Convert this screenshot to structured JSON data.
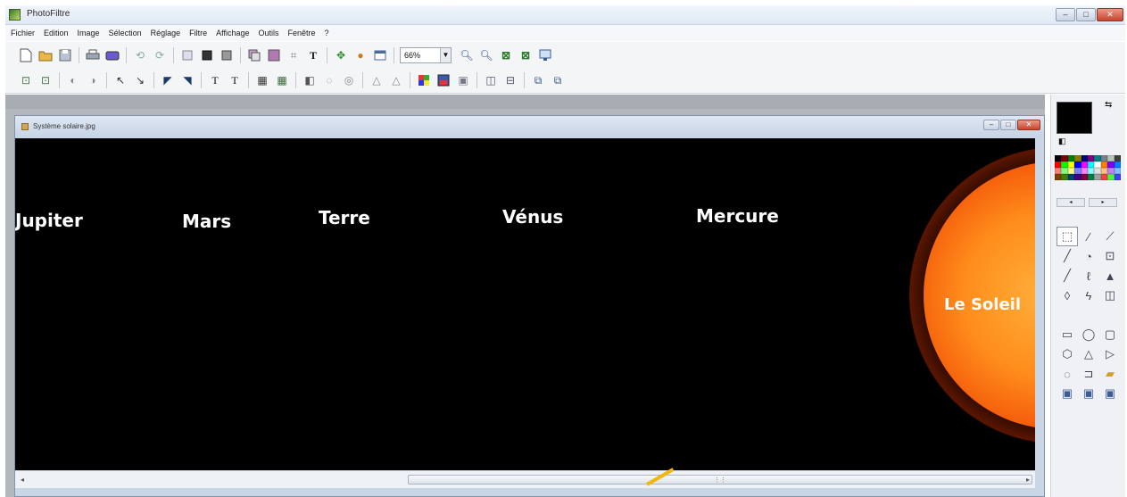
{
  "app": {
    "title": "PhotoFiltre"
  },
  "window_controls": {
    "minimize": "–",
    "maximize": "□",
    "close": "✕"
  },
  "menu": [
    "Fichier",
    "Edition",
    "Image",
    "Sélection",
    "Réglage",
    "Filtre",
    "Affichage",
    "Outils",
    "Fenêtre",
    "?"
  ],
  "toolbar1": {
    "group1": [
      "new-file-icon",
      "open-folder-icon",
      "save-icon"
    ],
    "group2": [
      "print-icon",
      "scanner-icon"
    ],
    "group3": [
      "undo-icon",
      "redo-icon"
    ],
    "group4": [
      "copy-icon",
      "paste-icon",
      "paste-new-icon"
    ],
    "group5": [
      "layer-icon",
      "layer-copy-icon",
      "crop-icon",
      "text-icon"
    ],
    "group6": [
      "move-icon",
      "stamp-icon",
      "window-icon"
    ],
    "zoom_value": "66%",
    "group7": [
      "zoom-in-icon",
      "zoom-out-icon",
      "actual-size-icon",
      "fit-window-icon",
      "fullscreen-icon"
    ]
  },
  "toolbar2": {
    "icons": [
      "resize-image-icon",
      "canvas-size-icon",
      "sharpen-icon",
      "blur-icon",
      "brightness-plus-icon",
      "brightness-minus-icon",
      "contrast-plus-icon",
      "contrast-minus-icon",
      "gamma-plus-icon",
      "gamma-minus-icon",
      "saturation-icon",
      "grayscale-icon",
      "sepia-icon",
      "invert-icon",
      "auto-levels-icon",
      "color-balance-icon",
      "histogram-icon",
      "flip-h-icon",
      "flip-v-icon",
      "rotate-icon",
      "transform-icon"
    ]
  },
  "document": {
    "title": "Système solaire.jpg",
    "labels": {
      "jupiter": "Jupiter",
      "mars": "Mars",
      "terre": "Terre",
      "venus": "Vénus",
      "mercure": "Mercure",
      "soleil": "Le Soleil"
    }
  },
  "colors": {
    "foreground": "#000000",
    "background": "#ffffff",
    "swatches": [
      "#000000",
      "#800000",
      "#008000",
      "#808000",
      "#000080",
      "#800080",
      "#008080",
      "#808080",
      "#c0c0c0",
      "#404040",
      "#ff0000",
      "#00ff00",
      "#ffff00",
      "#0000ff",
      "#ff00ff",
      "#00ffff",
      "#ffffff",
      "#ff8000",
      "#8000ff",
      "#0080ff",
      "#ff8080",
      "#80ff80",
      "#ffff80",
      "#8080ff",
      "#ff80ff",
      "#80ffff",
      "#e0e0e0",
      "#ffc080",
      "#c080ff",
      "#80c0ff",
      "#804000",
      "#408000",
      "#004080",
      "#400080",
      "#800040",
      "#008040",
      "#a0a0a0",
      "#ff4040",
      "#40ff40",
      "#4040ff"
    ]
  },
  "tools": [
    "selection-icon",
    "eyedropper-icon",
    "magic-wand-icon",
    "line-icon",
    "fill-icon",
    "spray-icon",
    "brush-icon",
    "effects-brush-icon",
    "clone-stamp-icon",
    "blur-drop-icon",
    "smudge-icon",
    "eraser-icon"
  ],
  "shape_tools": [
    "rectangle-icon",
    "ellipse-icon",
    "rounded-rect-icon",
    "hexagon-icon",
    "triangle-icon",
    "arrow-shape-icon",
    "lasso-icon",
    "polygon-icon",
    "folder-shape-icon",
    "crop-tool-icon",
    "text-tool-icon",
    "transform-tool-icon"
  ]
}
